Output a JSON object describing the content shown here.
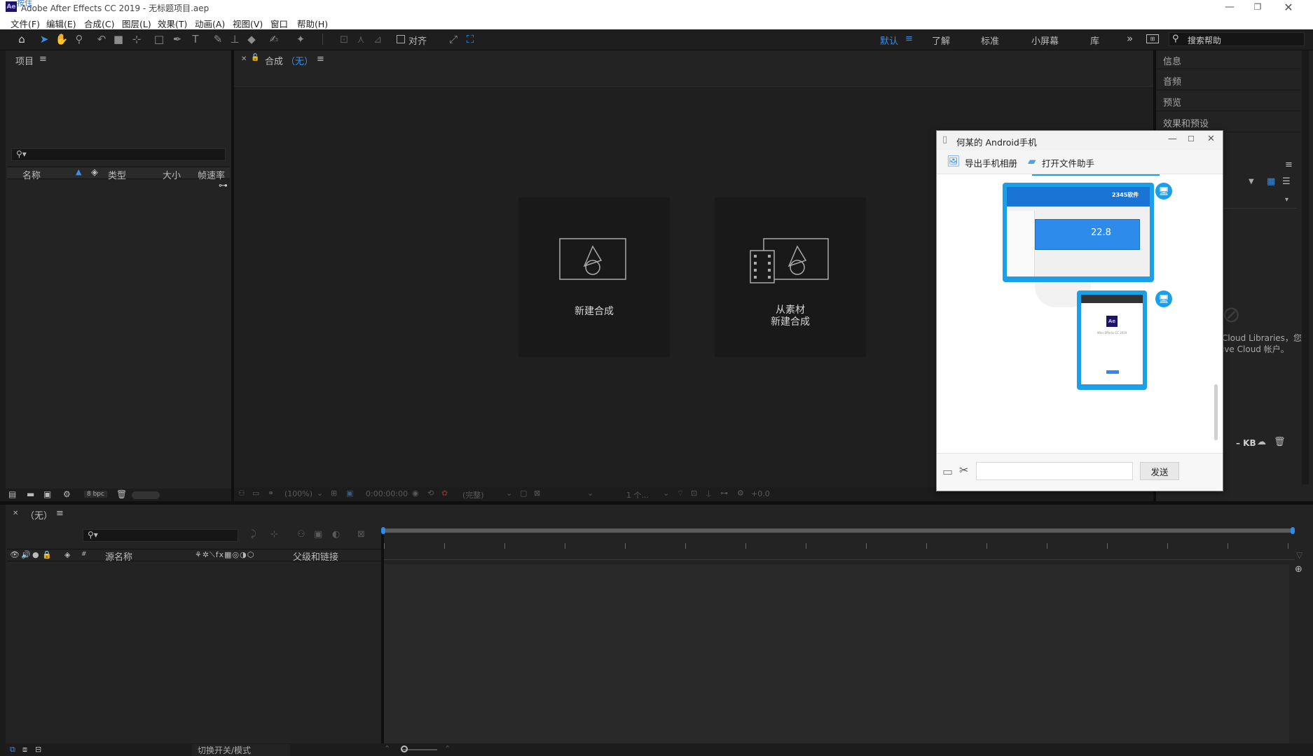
{
  "window": {
    "title": "Adobe After Effects CC 2019 - 无标题项目.aep",
    "app_icon": "Ae",
    "corner_text": "按住"
  },
  "menu": [
    "文件(F)",
    "编辑(E)",
    "合成(C)",
    "图层(L)",
    "效果(T)",
    "动画(A)",
    "视图(V)",
    "窗口",
    "帮助(H)"
  ],
  "toolbar": {
    "align_label": "对齐"
  },
  "workspaces": {
    "default": "默认",
    "learn": "了解",
    "standard": "标准",
    "small": "小屏幕",
    "library": "库",
    "search_placeholder": "搜索帮助"
  },
  "project": {
    "title": "项目",
    "columns": {
      "name": "名称",
      "type": "类型",
      "size": "大小",
      "fps": "帧速率"
    },
    "bpc": "8 bpc"
  },
  "composition": {
    "tab_label": "合成",
    "tab_value": "（无）",
    "new_comp": "新建合成",
    "from_footage_1": "从素材",
    "from_footage_2": "新建合成",
    "footer": {
      "zoom": "(100%)",
      "time": "0:00:00:00",
      "quality": "(完整)",
      "views": "1 个...",
      "offset": "+0.0"
    }
  },
  "right_panel": {
    "items": [
      "信息",
      "音频",
      "预览",
      "效果和预设"
    ],
    "cc_text_1": "Cloud Libraries，您",
    "cc_text_2": "ive Cloud 帐户。",
    "kb_text": "– KB"
  },
  "timeline": {
    "tab_label": "（无）",
    "columns": {
      "source_name": "源名称",
      "parent": "父级和链接",
      "hash": "#"
    },
    "footer_label": "切换开关/模式"
  },
  "popup": {
    "title": "何某的 Android手机",
    "export_album": "导出手机相册",
    "open_file_helper": "打开文件助手",
    "send_button": "发送",
    "thumb1_brand": "2345软件",
    "thumb1_progress": "22.8",
    "thumb2_icon": "Ae",
    "thumb2_text": "After Effects CC 2019"
  }
}
